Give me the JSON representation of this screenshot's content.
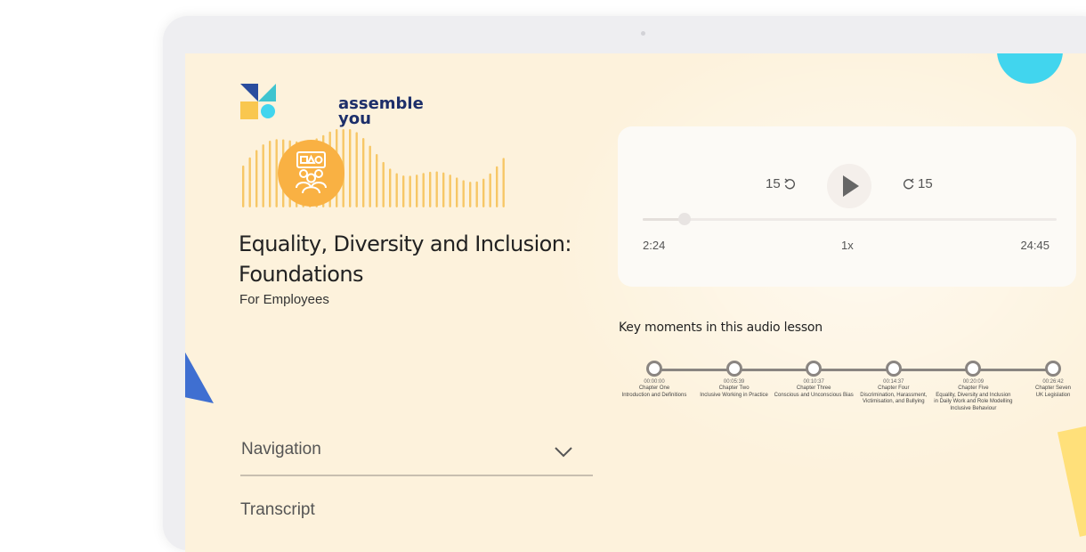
{
  "brand": {
    "name_line1": "assemble",
    "name_line2": "you"
  },
  "course": {
    "title": "Equality, Diversity and Inclusion: Foundations",
    "subtitle": "For Employees",
    "icon": "team-presentation-icon"
  },
  "player": {
    "skip_back_label": "15",
    "skip_forward_label": "15",
    "current_time": "2:24",
    "speed": "1x",
    "total_time": "24:45",
    "progress": 0.1
  },
  "key_moments": {
    "title": "Key moments in this audio lesson",
    "items": [
      {
        "time": "00:00:00",
        "chapter": "Chapter One",
        "label": "Introduction and Definitions"
      },
      {
        "time": "00:05:39",
        "chapter": "Chapter Two",
        "label": "Inclusive Working in Practice"
      },
      {
        "time": "00:10:37",
        "chapter": "Chapter Three",
        "label": "Conscious and Unconscious Bias"
      },
      {
        "time": "00:14:37",
        "chapter": "Chapter Four",
        "label": "Discrimination, Harassment, Victimisation, and Bullying"
      },
      {
        "time": "00:20:09",
        "chapter": "Chapter Five",
        "label": "Equality, Diversity and Inclusion in Daily Work and Role Modelling Inclusive Behaviour"
      },
      {
        "time": "00:26:42",
        "chapter": "Chapter Seven",
        "label": "UK Legislation"
      }
    ]
  },
  "sections": {
    "navigation_label": "Navigation",
    "transcript_label": "Transcript"
  },
  "colors": {
    "accent_orange": "#f9b143",
    "wave": "#f7c766",
    "brand_navy": "#1d2f6a",
    "brand_cyan": "#41d5ee",
    "background": "#fdf2dc"
  }
}
